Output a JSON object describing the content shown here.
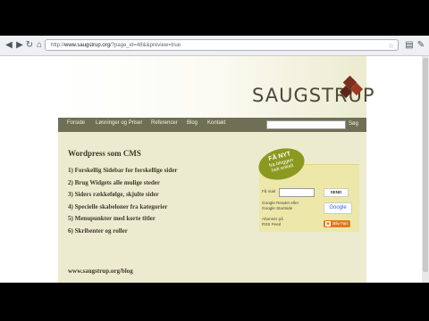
{
  "browser": {
    "url_prefix": "http://",
    "url_host": "www.saugstrup.org",
    "url_path": "/?page_id=48&&preview=true",
    "nav_icons": [
      "back-icon",
      "forward-icon",
      "reload-icon",
      "home-icon"
    ],
    "right_icons": [
      "page-menu-icon",
      "wrench-icon"
    ]
  },
  "site": {
    "logo": "SAUGSTRUP",
    "nav": [
      "Forside",
      "Løsninger og Priser",
      "Referencer",
      "Blog",
      "Kontakt"
    ],
    "search_button": "Søg"
  },
  "content": {
    "title": "Wordpress som CMS",
    "items": [
      "1) Forskellig Sidebar for forskellige sider",
      "2) Brug Widgets alle mulige steder",
      "3) Siders rækkefølge, skjulte sider",
      "4) Specielle skabeloner fra kategorier",
      "5) Menupunkter med korte titler",
      "6) Skribenter og roller"
    ],
    "footer_link": "www.saugstrup.org/blog"
  },
  "widget": {
    "badge_line1": "FÅ NYT",
    "badge_line2": "fra bloggen",
    "badge_line3": "helt enkelt",
    "mail_label": "Få mail",
    "send": "SEND",
    "google_reader_line1": "Google Reader eller",
    "google_reader_line2": "Google Startside",
    "google": "Google",
    "rss_line1": "Abonnér på",
    "rss_line2": "RSS Feed",
    "rss_button": "Bliv Fan"
  }
}
